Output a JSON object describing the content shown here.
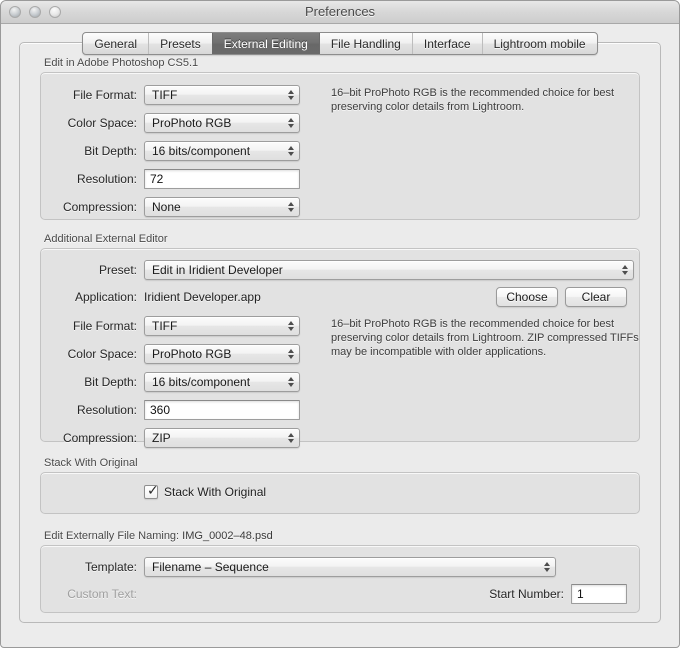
{
  "window": {
    "title": "Preferences",
    "traffic_lights": [
      "close-button",
      "minimize-button",
      "zoom-button"
    ]
  },
  "tabs": [
    {
      "label": "General",
      "selected": false
    },
    {
      "label": "Presets",
      "selected": false
    },
    {
      "label": "External Editing",
      "selected": true
    },
    {
      "label": "File Handling",
      "selected": false
    },
    {
      "label": "Interface",
      "selected": false
    },
    {
      "label": "Lightroom mobile",
      "selected": false
    }
  ],
  "photoshop_section": {
    "title": "Edit in Adobe Photoshop CS5.1",
    "help_text": "16–bit ProPhoto RGB is the recommended choice for best preserving color details from Lightroom.",
    "fields": {
      "file_format_label": "File Format:",
      "file_format_value": "TIFF",
      "color_space_label": "Color Space:",
      "color_space_value": "ProPhoto RGB",
      "bit_depth_label": "Bit Depth:",
      "bit_depth_value": "16 bits/component",
      "resolution_label": "Resolution:",
      "resolution_value": "72",
      "compression_label": "Compression:",
      "compression_value": "None"
    }
  },
  "additional_editor_section": {
    "title": "Additional External Editor",
    "help_text": "16–bit ProPhoto RGB is the recommended choice for best preserving color details from Lightroom. ZIP compressed TIFFs may be incompatible with older applications.",
    "choose_button": "Choose",
    "clear_button": "Clear",
    "fields": {
      "preset_label": "Preset:",
      "preset_value": "Edit in Iridient Developer",
      "application_label": "Application:",
      "application_value": "Iridient Developer.app",
      "file_format_label": "File Format:",
      "file_format_value": "TIFF",
      "color_space_label": "Color Space:",
      "color_space_value": "ProPhoto RGB",
      "bit_depth_label": "Bit Depth:",
      "bit_depth_value": "16 bits/component",
      "resolution_label": "Resolution:",
      "resolution_value": "360",
      "compression_label": "Compression:",
      "compression_value": "ZIP"
    }
  },
  "stack_section": {
    "title": "Stack With Original",
    "checkbox_label": "Stack With Original",
    "checked": true,
    "check_glyph": "✓"
  },
  "file_naming_section": {
    "title": "Edit Externally File Naming:",
    "sample_filename": "IMG_0002–48.psd",
    "template_label": "Template:",
    "template_value": "Filename – Sequence",
    "custom_text_label": "Custom Text:",
    "custom_text_value": "",
    "start_number_label": "Start Number:",
    "start_number_value": "1"
  },
  "colors": {
    "window_bg": "#ececec",
    "panel_bg": "#ebebeb",
    "group_bg": "#e2e2e2",
    "selected_tab_bg": "#6f6f6f",
    "selected_tab_fg": "#ffffff"
  }
}
